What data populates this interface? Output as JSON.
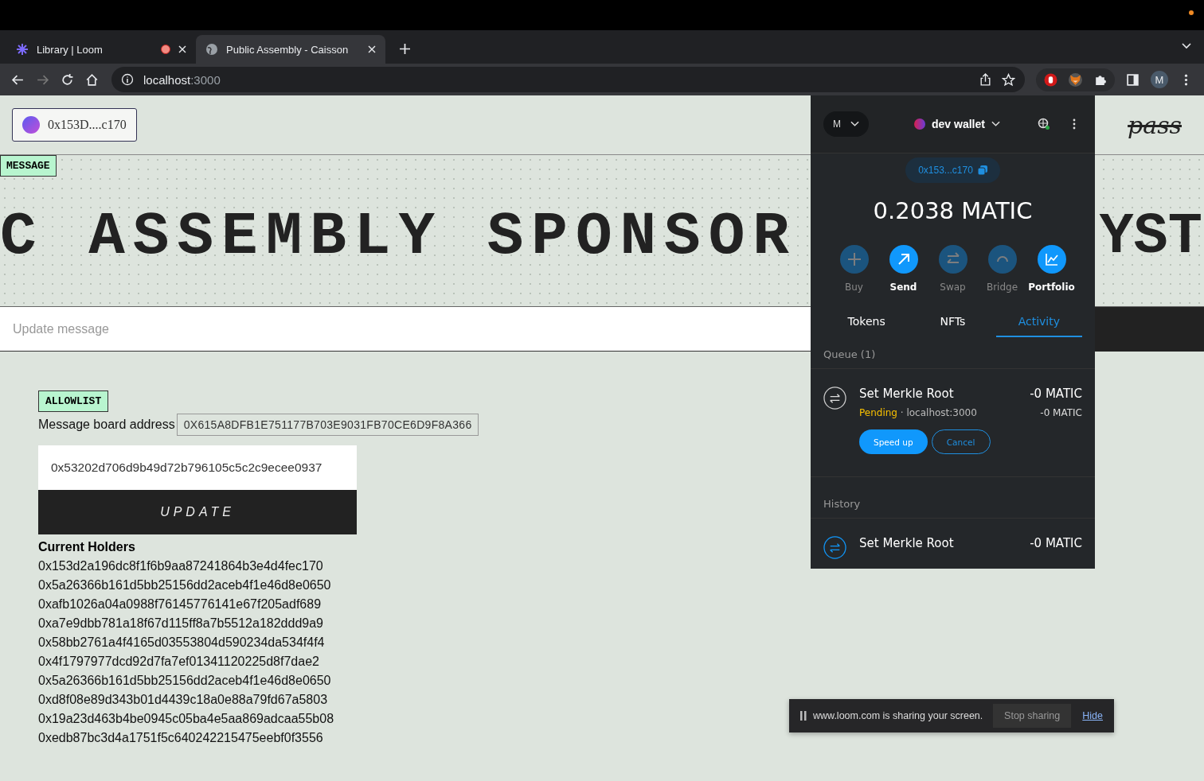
{
  "browser": {
    "tabs": [
      {
        "title": "Library | Loom",
        "selected": false,
        "recording": true
      },
      {
        "title": "Public Assembly - Caisson",
        "selected": true,
        "recording": false
      }
    ],
    "address": {
      "host": "localhost",
      "port": ":3000"
    },
    "profile": "M"
  },
  "page": {
    "wallet_button": "0x153D....c170",
    "logo": "pass",
    "message_tag": "MESSAGE",
    "banner_left": "C ASSEMBLY SPONSOR",
    "banner_right": "YST",
    "message_placeholder": "Update message",
    "allowlist_tag": "ALLOWLIST",
    "board_label": "Message board address",
    "board_address": "0X615A8DFB1E751177B703E9031FB70CE6D9F8A366",
    "root_value": "0x53202d706d9b49d72b796105c5c2c9ecee0937",
    "update_button": "UPDATE",
    "holders_title": "Current Holders",
    "holders": [
      "0x153d2a196dc8f1f6b9aa87241864b3e4d4fec170",
      "0x5a26366b161d5bb25156dd2aceb4f1e46d8e0650",
      "0xafb1026a04a0988f76145776141e67f205adf689",
      "0xa7e9dbb781a18f67d115ff8a7b5512a182ddd9a9",
      "0x58bb2761a4f4165d03553804d590234da534f4f4",
      "0x4f1797977dcd92d7fa7ef01341120225d8f7dae2",
      "0x5a26366b161d5bb25156dd2aceb4f1e46d8e0650",
      "0xd8f08e89d343b01d4439c18a0e88a79fd67a5803",
      "0x19a23d463b4be0945c05ba4e5aa869adcaa55b08",
      "0xedb87bc3d4a1751f5c640242215475eebf0f3556"
    ]
  },
  "wallet": {
    "account_chip": "M",
    "account_name": "dev wallet",
    "address": "0x153...c170",
    "balance": "0.2038 MATIC",
    "actions": [
      {
        "label": "Buy",
        "kind": "plus",
        "disabled": true
      },
      {
        "label": "Send",
        "kind": "send",
        "disabled": false
      },
      {
        "label": "Swap",
        "kind": "swap",
        "disabled": true
      },
      {
        "label": "Bridge",
        "kind": "bridge",
        "disabled": true
      },
      {
        "label": "Portfolio",
        "kind": "chart",
        "disabled": false
      }
    ],
    "tabs": [
      {
        "label": "Tokens",
        "selected": false
      },
      {
        "label": "NFTs",
        "selected": false
      },
      {
        "label": "Activity",
        "selected": true
      }
    ],
    "queue_label": "Queue (1)",
    "queue": [
      {
        "title": "Set Merkle Root",
        "amount": "-0 MATIC",
        "status": "Pending",
        "origin": " · localhost:3000",
        "secondary_amount": "-0 MATIC",
        "buttons": [
          "Speed up",
          "Cancel"
        ]
      }
    ],
    "history_label": "History",
    "history": [
      {
        "title": "Set Merkle Root",
        "amount": "-0 MATIC"
      }
    ]
  },
  "share_bar": {
    "message": "www.loom.com is sharing your screen.",
    "stop": "Stop sharing",
    "hide": "Hide"
  }
}
